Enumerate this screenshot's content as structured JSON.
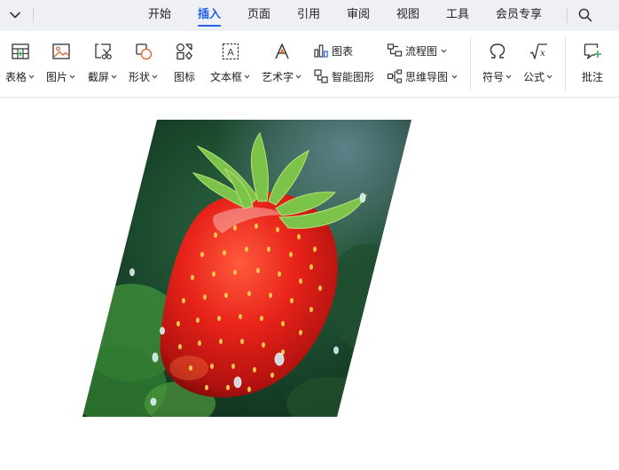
{
  "menubar": {
    "tabs": [
      {
        "label": "开始"
      },
      {
        "label": "插入"
      },
      {
        "label": "页面"
      },
      {
        "label": "引用"
      },
      {
        "label": "审阅"
      },
      {
        "label": "视图"
      },
      {
        "label": "工具"
      },
      {
        "label": "会员专享"
      }
    ],
    "active_tab": "插入",
    "accent_color": "#2362e6"
  },
  "ribbon": {
    "table": {
      "label": "表格",
      "icon": "table-icon"
    },
    "picture": {
      "label": "图片",
      "icon": "picture-icon"
    },
    "screenshot": {
      "label": "截屏",
      "icon": "scissors-icon"
    },
    "shape": {
      "label": "形状",
      "icon": "shape-icon"
    },
    "icons": {
      "label": "图标",
      "icon": "icons-icon"
    },
    "textbox": {
      "label": "文本框",
      "icon": "textbox-icon"
    },
    "wordart": {
      "label": "艺术字",
      "icon": "wordart-icon"
    },
    "chart": {
      "label": "图表",
      "icon": "chart-icon"
    },
    "smartart": {
      "label": "智能图形",
      "icon": "smartart-icon"
    },
    "flowchart": {
      "label": "流程图",
      "icon": "flowchart-icon"
    },
    "mindmap": {
      "label": "思维导图",
      "icon": "mindmap-icon"
    },
    "symbol": {
      "label": "符号",
      "icon": "omega-icon"
    },
    "formula": {
      "label": "公式",
      "icon": "sqrt-icon"
    },
    "comment": {
      "label": "批注",
      "icon": "comment-add-icon"
    }
  },
  "document": {
    "image": {
      "shape": "parallelogram",
      "subject": "strawberry-photo"
    }
  }
}
